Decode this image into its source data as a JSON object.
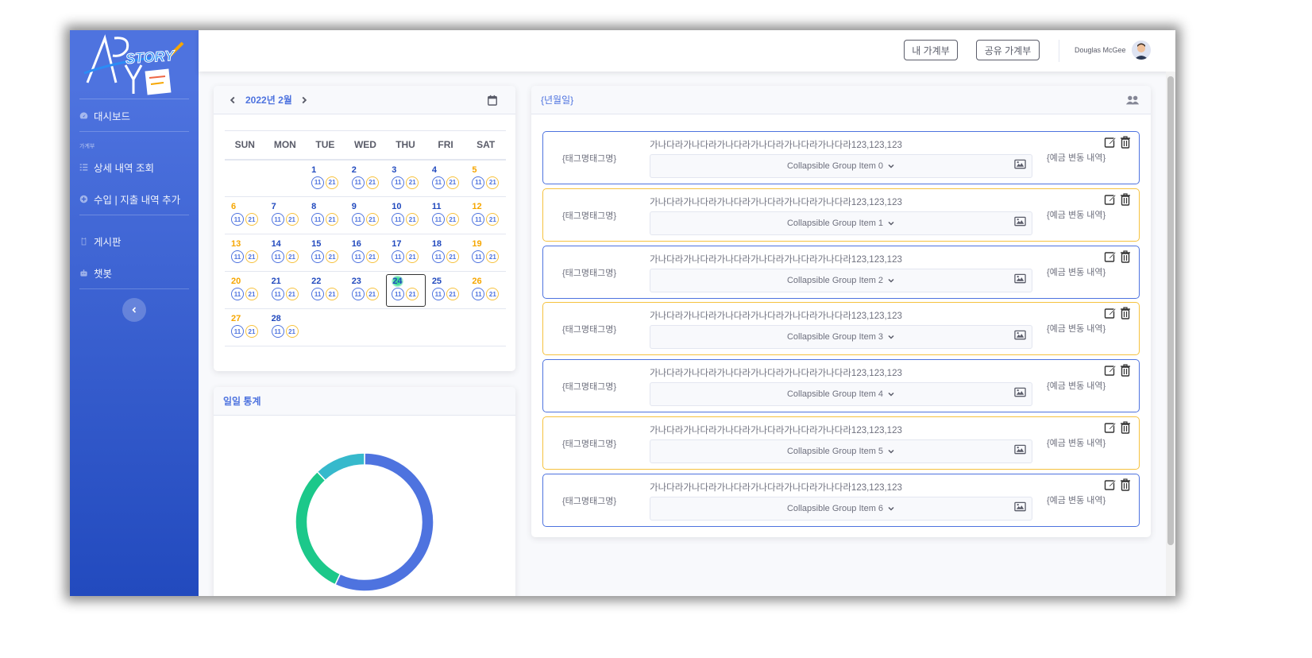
{
  "sidebar": {
    "logo_text": "STORY",
    "dashboard": "대시보드",
    "heading": "가계부",
    "detail": "상세 내역 조회",
    "add": "수입 | 지출 내역 추가",
    "board": "게시판",
    "chatbot": "챗봇"
  },
  "topbar": {
    "my_book": "내 가계부",
    "shared_book": "공유 가계부",
    "user_name": "Douglas McGee"
  },
  "calendar": {
    "title": "2022년 2월",
    "weekdays": [
      "SUN",
      "MON",
      "TUE",
      "WED",
      "THU",
      "FRI",
      "SAT"
    ],
    "badge_a": "11",
    "badge_b": "21",
    "weeks": [
      [
        "",
        "",
        "1",
        "2",
        "3",
        "4",
        "5"
      ],
      [
        "6",
        "7",
        "8",
        "9",
        "10",
        "11",
        "12"
      ],
      [
        "13",
        "14",
        "15",
        "16",
        "17",
        "18",
        "19"
      ],
      [
        "20",
        "21",
        "22",
        "23",
        "24",
        "25",
        "26"
      ],
      [
        "27",
        "28",
        "",
        "",
        "",
        "",
        ""
      ]
    ],
    "today": "24"
  },
  "stats": {
    "title": "일일 통계"
  },
  "chart_data": {
    "type": "pie",
    "title": "",
    "series": [
      {
        "values": [
          57,
          31,
          12
        ]
      }
    ],
    "colors": [
      "#4e73df",
      "#1cc88a",
      "#36b9cc"
    ]
  },
  "detail": {
    "title": "{년월일}",
    "entries": [
      {
        "tag": "{태그명태그명}",
        "text": "가나다라가나다라가나다라가나다라가나다라가나다라123,123,123",
        "collapse": "Collapsible Group Item 0",
        "deposit": "{예금 변동 내역}",
        "style": "blue"
      },
      {
        "tag": "{태그명태그명}",
        "text": "가나다라가나다라가나다라가나다라가나다라가나다라123,123,123",
        "collapse": "Collapsible Group Item 1",
        "deposit": "{예금 변동 내역}",
        "style": "yellow"
      },
      {
        "tag": "{태그명태그명}",
        "text": "가나다라가나다라가나다라가나다라가나다라가나다라123,123,123",
        "collapse": "Collapsible Group Item 2",
        "deposit": "{예금 변동 내역}",
        "style": "blue"
      },
      {
        "tag": "{태그명태그명}",
        "text": "가나다라가나다라가나다라가나다라가나다라가나다라123,123,123",
        "collapse": "Collapsible Group Item 3",
        "deposit": "{예금 변동 내역}",
        "style": "yellow"
      },
      {
        "tag": "{태그명태그명}",
        "text": "가나다라가나다라가나다라가나다라가나다라가나다라123,123,123",
        "collapse": "Collapsible Group Item 4",
        "deposit": "{예금 변동 내역}",
        "style": "blue"
      },
      {
        "tag": "{태그명태그명}",
        "text": "가나다라가나다라가나다라가나다라가나다라가나다라123,123,123",
        "collapse": "Collapsible Group Item 5",
        "deposit": "{예금 변동 내역}",
        "style": "yellow"
      },
      {
        "tag": "{태그명태그명}",
        "text": "가나다라가나다라가나다라가나다라가나다라가나다라123,123,123",
        "collapse": "Collapsible Group Item 6",
        "deposit": "{예금 변동 내역}",
        "style": "blue"
      }
    ]
  }
}
